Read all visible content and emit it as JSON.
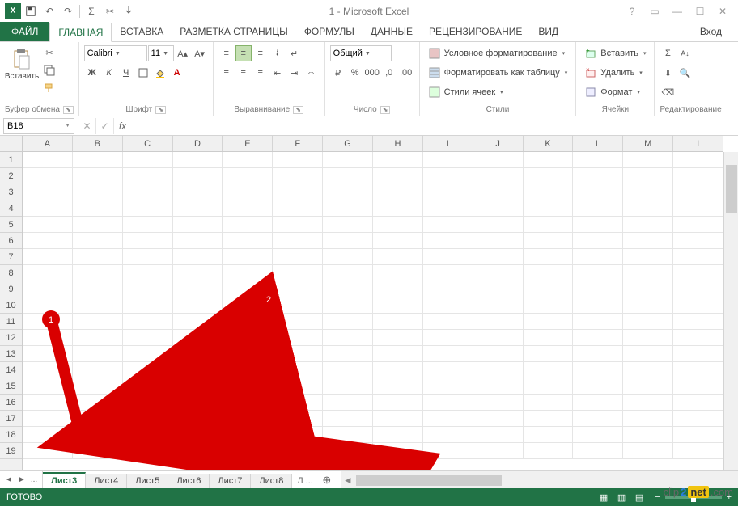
{
  "title": "1 - Microsoft Excel",
  "qat": {
    "undo": "↶",
    "redo": "↷",
    "save": "💾",
    "sigma": "Σ",
    "cut": "✂",
    "touch": "☝"
  },
  "tabs": {
    "file": "ФАЙЛ",
    "home": "ГЛАВНАЯ",
    "insert": "ВСТАВКА",
    "layout": "РАЗМЕТКА СТРАНИЦЫ",
    "formulas": "ФОРМУЛЫ",
    "data": "ДАННЫЕ",
    "review": "РЕЦЕНЗИРОВАНИЕ",
    "view": "ВИД"
  },
  "signin": "Вход",
  "ribbon": {
    "clipboard": {
      "label": "Буфер обмена",
      "paste": "Вставить"
    },
    "font": {
      "label": "Шрифт",
      "name": "Calibri",
      "size": "11",
      "bold": "Ж",
      "italic": "К",
      "underline": "Ч"
    },
    "align": {
      "label": "Выравнивание"
    },
    "number": {
      "label": "Число",
      "format": "Общий"
    },
    "styles": {
      "label": "Стили",
      "cond": "Условное форматирование",
      "table": "Форматировать как таблицу",
      "cell": "Стили ячеек"
    },
    "cells": {
      "label": "Ячейки",
      "insert": "Вставить",
      "delete": "Удалить",
      "format": "Формат"
    },
    "editing": {
      "label": "Редактирование"
    }
  },
  "namebox": "B18",
  "columns": [
    "A",
    "B",
    "C",
    "D",
    "E",
    "F",
    "G",
    "H",
    "I",
    "J",
    "K",
    "L",
    "M",
    "I"
  ],
  "rows": [
    "1",
    "2",
    "3",
    "4",
    "5",
    "6",
    "7",
    "8",
    "9",
    "10",
    "11",
    "12",
    "13",
    "14",
    "15",
    "16",
    "17",
    "18",
    "19"
  ],
  "sheets": {
    "ellipsis": "...",
    "active": "Лист3",
    "tabs": [
      "Лист4",
      "Лист5",
      "Лист6",
      "Лист7",
      "Лист8"
    ],
    "more": "Л"
  },
  "status": "ГОТОВО",
  "annotations": {
    "a1": "1",
    "a2": "2"
  },
  "watermark": {
    "brand": "clip",
    "two": "2",
    "net": "net",
    "suffix": ".com"
  }
}
